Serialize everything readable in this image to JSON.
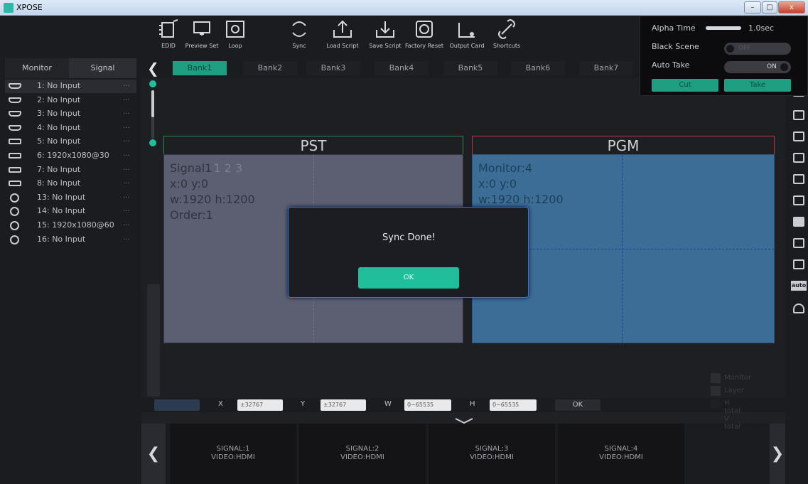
{
  "window": {
    "title": "XPOSE",
    "minimize": "–",
    "maximize": "□",
    "close": "x"
  },
  "toolbar": {
    "items": [
      {
        "label": "EDID",
        "icon": "edid-icon"
      },
      {
        "label": "Preview Set",
        "icon": "preview-set-icon"
      },
      {
        "label": "Loop",
        "icon": "loop-icon"
      },
      {
        "label": "Sync",
        "icon": "sync-icon"
      },
      {
        "label": "Load Script",
        "icon": "load-script-icon"
      },
      {
        "label": "Save Script",
        "icon": "save-script-icon"
      },
      {
        "label": "Factory Reset",
        "icon": "factory-reset-icon"
      },
      {
        "label": "Output Card",
        "icon": "output-card-icon"
      },
      {
        "label": "Shortcuts",
        "icon": "shortcuts-icon"
      }
    ]
  },
  "quick_panel": {
    "alpha_time_label": "Alpha Time",
    "alpha_time_value": "1.0sec",
    "black_scene_label": "Black Scene",
    "black_scene_state": "OFF",
    "auto_take_label": "Auto Take",
    "auto_take_state": "ON",
    "cut_label": "Cut",
    "take_label": "Take",
    "accent": "#1f9f81"
  },
  "sidebar": {
    "tabs": [
      "Monitor",
      "Signal"
    ],
    "signals": [
      {
        "label": "1: No Input",
        "type": "hdmi"
      },
      {
        "label": "2: No Input",
        "type": "hdmi"
      },
      {
        "label": "3: No Input",
        "type": "hdmi"
      },
      {
        "label": "4: No Input",
        "type": "hdmi"
      },
      {
        "label": "5: No Input",
        "type": "dvi"
      },
      {
        "label": "6: 1920x1080@30",
        "type": "dvi"
      },
      {
        "label": "7: No Input",
        "type": "dvi"
      },
      {
        "label": "8: No Input",
        "type": "dvi"
      },
      {
        "label": "13: No Input",
        "type": "sdi"
      },
      {
        "label": "14: No Input",
        "type": "sdi"
      },
      {
        "label": "15: 1920x1080@60",
        "type": "sdi"
      },
      {
        "label": "16: No Input",
        "type": "sdi"
      }
    ],
    "more": "..."
  },
  "banks": {
    "prev": "❮",
    "items": [
      "Bank1",
      "Bank2",
      "Bank3",
      "Bank4",
      "Bank5",
      "Bank6",
      "Bank7"
    ],
    "active_index": 0
  },
  "preview": {
    "pst_title": "PST",
    "pgm_title": "PGM",
    "pst_lines": [
      "Signal1",
      "x:0  y:0",
      "w:1920  h:1200",
      "Order:1"
    ],
    "pst_faded": "1 2 3",
    "pgm_lines": [
      "Monitor:4",
      "x:0  y:0",
      "w:1920  h:1200"
    ]
  },
  "coords": {
    "x_label": "X",
    "x_placeholder": "±32767",
    "y_label": "Y",
    "y_placeholder": "±32767",
    "w_label": "W",
    "w_placeholder": "0~65535",
    "h_label": "H",
    "h_placeholder": "0~65535",
    "ok_label": "OK"
  },
  "legend": [
    "Monitor",
    "Layer",
    "H total V total"
  ],
  "sources": [
    {
      "signal": "SIGNAL:1",
      "video": "VIDEO:HDMI"
    },
    {
      "signal": "SIGNAL:2",
      "video": "VIDEO:HDMI"
    },
    {
      "signal": "SIGNAL:3",
      "video": "VIDEO:HDMI"
    },
    {
      "signal": "SIGNAL:4",
      "video": "VIDEO:HDMI"
    }
  ],
  "source_nav": {
    "prev": "❮",
    "next": "❯"
  },
  "right_tools": [
    "layer-copy-icon",
    "window-icon",
    "window-icon",
    "window-icon",
    "image-icon",
    "image-plus-icon",
    "close-box-icon",
    "copy-icon",
    "page-icon",
    "auto-icon",
    "on-icon"
  ],
  "right_tool_auto_label": "auto",
  "dialog": {
    "message": "Sync Done!",
    "ok_label": "OK"
  }
}
